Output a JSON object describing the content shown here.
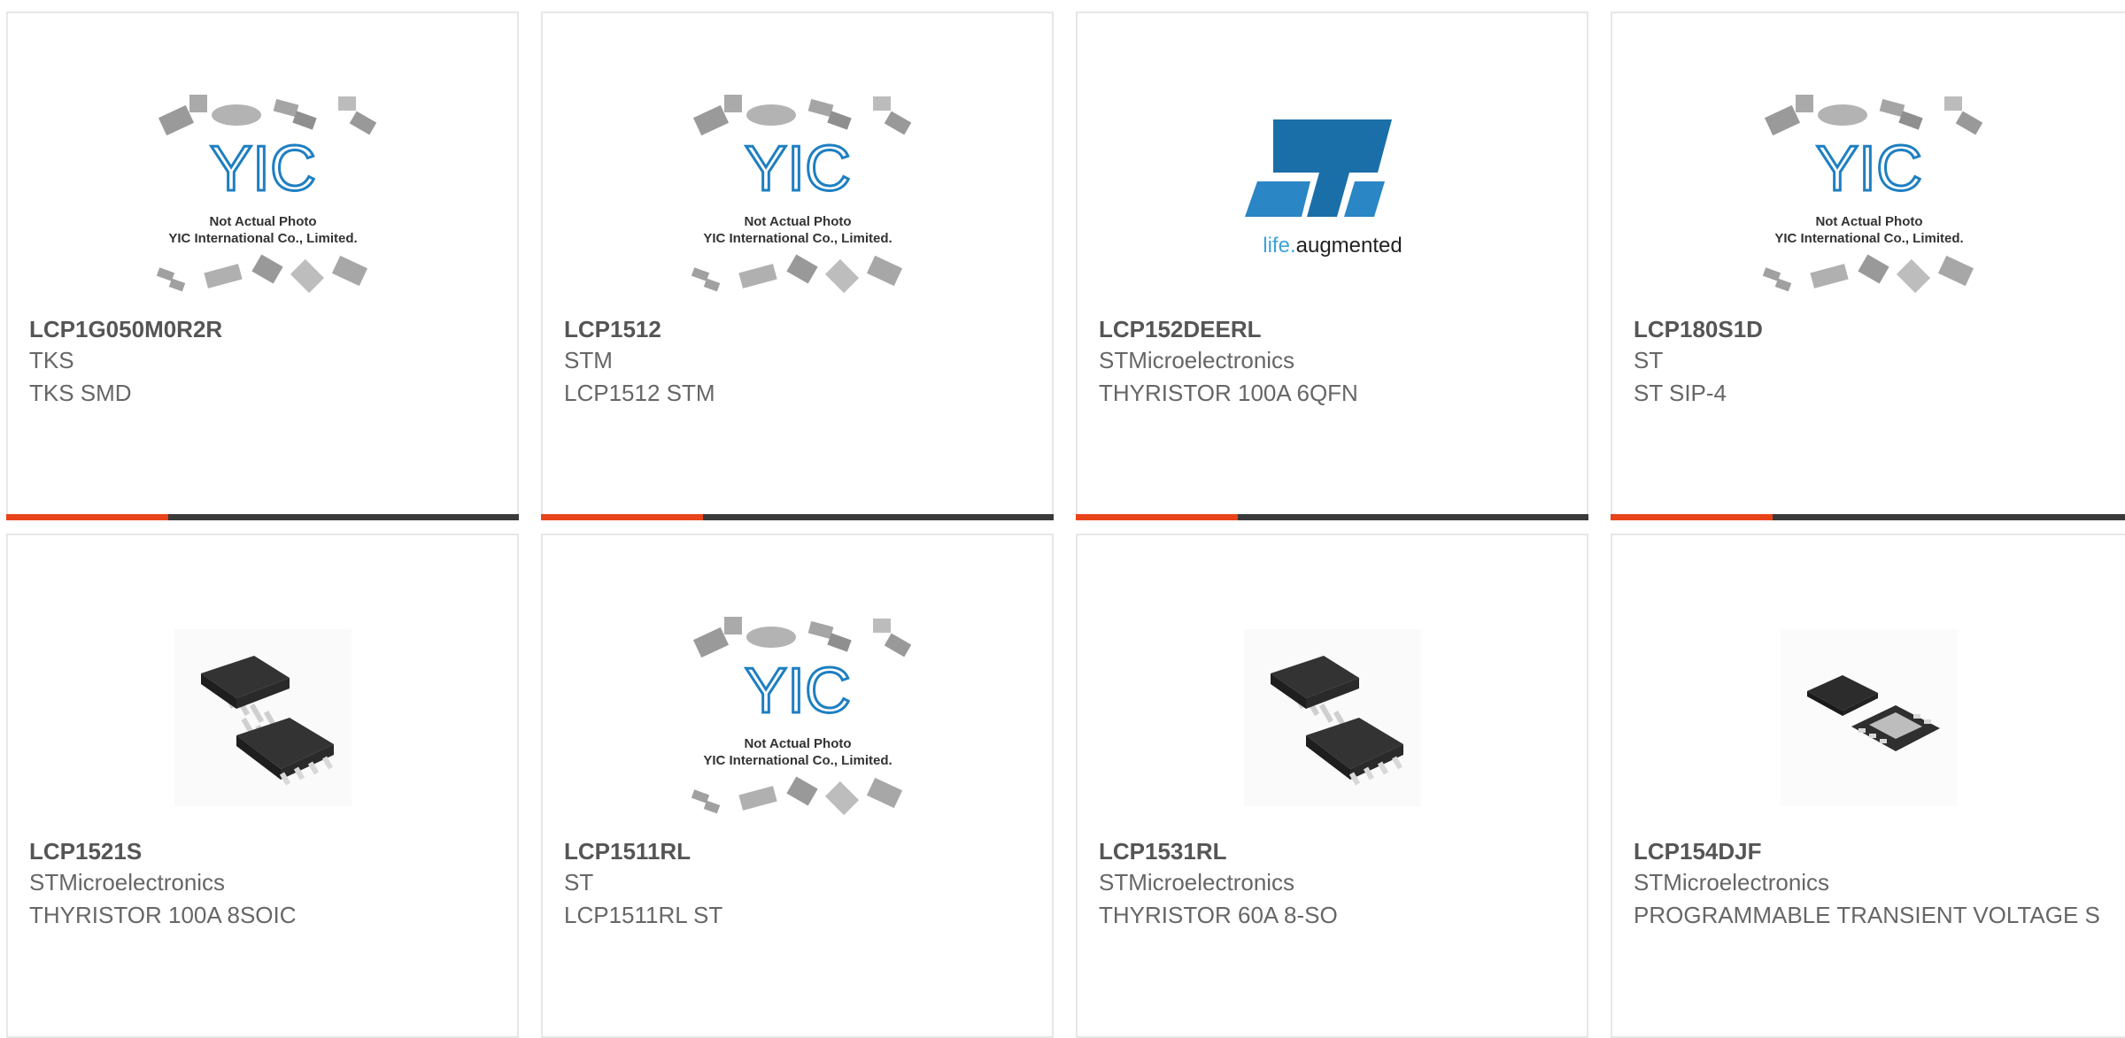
{
  "colors": {
    "accent": "#e8431a",
    "dark": "#3a3a3a",
    "border": "#e7e7e7",
    "yic_blue": "#1e7fc1",
    "st_blue": "#1b6fa8"
  },
  "placeholder": {
    "logo_text": "YIC",
    "caption_line1": "Not Actual Photo",
    "caption_line2": "YIC International Co., Limited."
  },
  "st_logo": {
    "tagline_a": "life.",
    "tagline_b": "augmented"
  },
  "products": [
    {
      "part": "LCP1G050M0R2R",
      "brand": "TKS",
      "desc": "TKS SMD",
      "image": "placeholder"
    },
    {
      "part": "LCP1512",
      "brand": "STM",
      "desc": "LCP1512 STM",
      "image": "placeholder"
    },
    {
      "part": "LCP152DEERL",
      "brand": "STMicroelectronics",
      "desc": "THYRISTOR 100A 6QFN",
      "image": "st-logo"
    },
    {
      "part": "LCP180S1D",
      "brand": "ST",
      "desc": "ST SIP-4",
      "image": "placeholder"
    },
    {
      "part": "LCP1521S",
      "brand": "STMicroelectronics",
      "desc": "THYRISTOR 100A 8SOIC",
      "image": "soic8"
    },
    {
      "part": "LCP1511RL",
      "brand": "ST",
      "desc": "LCP1511RL ST",
      "image": "placeholder"
    },
    {
      "part": "LCP1531RL",
      "brand": "STMicroelectronics",
      "desc": "THYRISTOR 60A 8-SO",
      "image": "soic8"
    },
    {
      "part": "LCP154DJF",
      "brand": "STMicroelectronics",
      "desc": "PROGRAMMABLE TRANSIENT VOLTAGE S",
      "image": "qfn"
    }
  ]
}
